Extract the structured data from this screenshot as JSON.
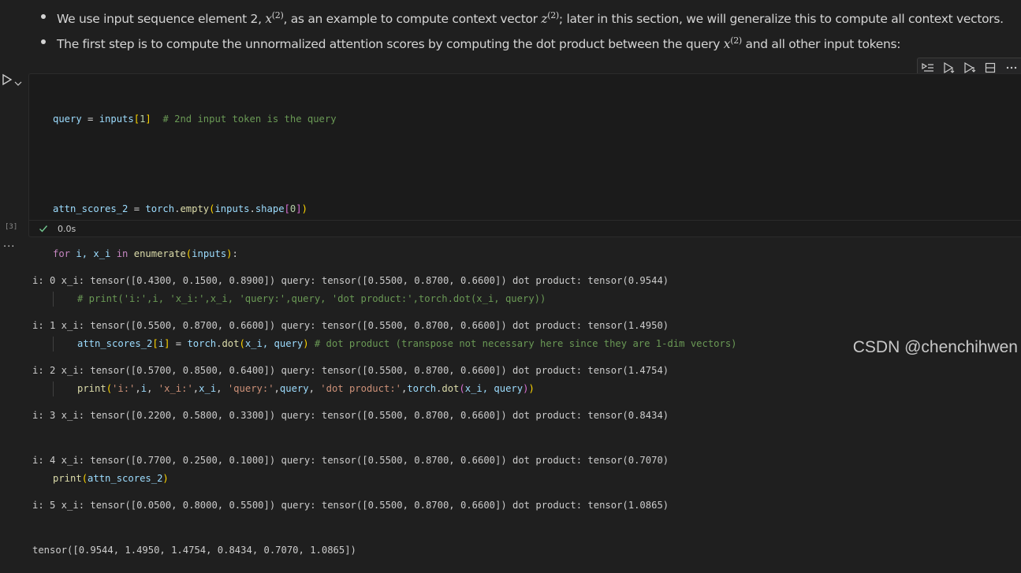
{
  "markdown": {
    "bullet1": {
      "a": "We use input sequence element 2, ",
      "x": "x",
      "sup1": "(2)",
      "b": ", as an example to compute context vector ",
      "z": "z",
      "sup2": "(2)",
      "c": "; later in this section, we will generalize this to compute all context vectors."
    },
    "bullet2": {
      "a": "The first step is to compute the unnormalized attention scores by computing the dot product between the query ",
      "x": "x",
      "sup": "(2)",
      "b": " and all other input tokens:"
    }
  },
  "toolbar": {
    "icons": [
      "execute-above-icon",
      "execute-below-icon",
      "split-cell-icon",
      "more-icon"
    ]
  },
  "cell": {
    "execution_count": "[3]",
    "elapsed": "0.0s",
    "code": {
      "l1_var": "query",
      "l1_eq": " = ",
      "l1_obj": "inputs",
      "l1_idx": "1",
      "l1_comment": "  # 2nd input token is the query",
      "l3_var": "attn_scores_2",
      "l3_eq": " = ",
      "l3_mod": "torch",
      "l3_fn": "empty",
      "l3_arg": "inputs",
      "l3_attr": "shape",
      "l3_idx": "0",
      "l4_for": "for",
      "l4_vars": " i, x_i ",
      "l4_in": "in",
      "l4_fn": "enumerate",
      "l4_arg": "inputs",
      "l5_comment": "# print('i:',i, 'x_i:',x_i, 'query:',query, 'dot product:',torch.dot(x_i, query))",
      "l6_var": "attn_scores_2",
      "l6_i": "i",
      "l6_mod": "torch",
      "l6_fn": "dot",
      "l6_args": "x_i, query",
      "l6_comment": " # dot product (transpose not necessary here since they are 1-dim vectors)",
      "l7_fn": "print",
      "l7_s1": "'i:'",
      "l7_a1": "i",
      "l7_s2": "'x_i:'",
      "l7_a2": "x_i",
      "l7_s3": "'query:'",
      "l7_a3": "query",
      "l7_s4": "'dot product:'",
      "l7_mod": "torch",
      "l7_fn2": "dot",
      "l7_args": "x_i, query",
      "l9_fn": "print",
      "l9_arg": "attn_scores_2"
    }
  },
  "output": {
    "more": "···",
    "lines": [
      "i: 0 x_i: tensor([0.4300, 0.1500, 0.8900]) query: tensor([0.5500, 0.8700, 0.6600]) dot product: tensor(0.9544)",
      "i: 1 x_i: tensor([0.5500, 0.8700, 0.6600]) query: tensor([0.5500, 0.8700, 0.6600]) dot product: tensor(1.4950)",
      "i: 2 x_i: tensor([0.5700, 0.8500, 0.6400]) query: tensor([0.5500, 0.8700, 0.6600]) dot product: tensor(1.4754)",
      "i: 3 x_i: tensor([0.2200, 0.5800, 0.3300]) query: tensor([0.5500, 0.8700, 0.6600]) dot product: tensor(0.8434)",
      "i: 4 x_i: tensor([0.7700, 0.2500, 0.1000]) query: tensor([0.5500, 0.8700, 0.6600]) dot product: tensor(0.7070)",
      "i: 5 x_i: tensor([0.0500, 0.8000, 0.5500]) query: tensor([0.5500, 0.8700, 0.6600]) dot product: tensor(1.0865)",
      "tensor([0.9544, 1.4950, 1.4754, 0.8434, 0.7070, 1.0865])"
    ]
  },
  "watermark": "CSDN @chenchihwen"
}
